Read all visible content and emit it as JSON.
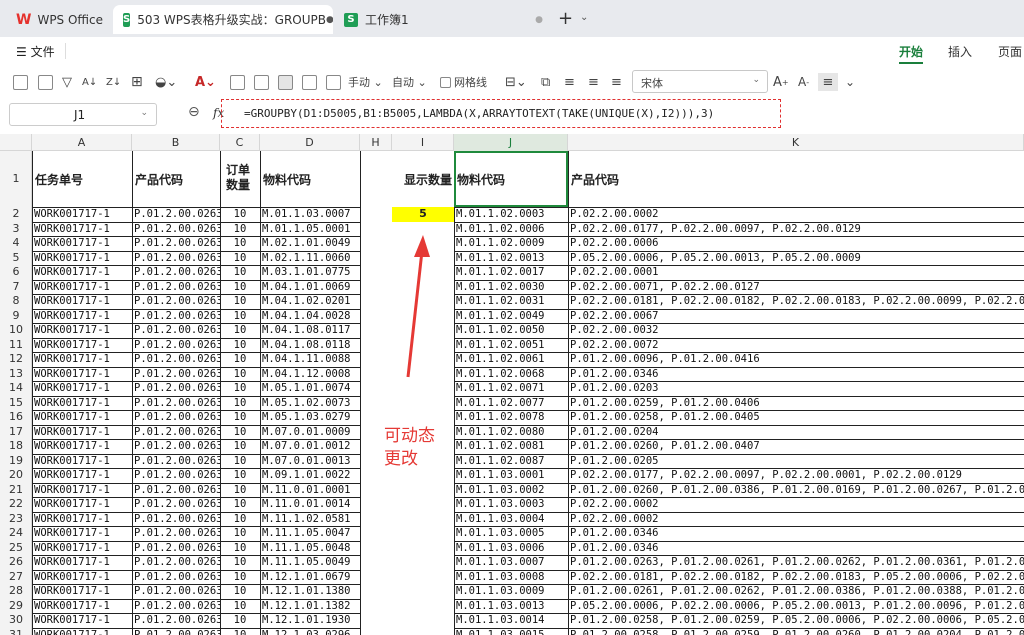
{
  "tabs": [
    {
      "label": "WPS Office"
    },
    {
      "label": "503 WPS表格升级实战：GROUPB"
    },
    {
      "label": "工作簿1"
    }
  ],
  "menu": {
    "file": "文件",
    "tabs": [
      "开始",
      "插入",
      "页面"
    ]
  },
  "toolbar": {
    "font": "宋体",
    "handle": "手动",
    "auto": "自动",
    "gridlines": "网格线"
  },
  "formula_bar": {
    "name_box": "J1",
    "formula": "=GROUPBY(D1:D5005,B1:B5005,LAMBDA(X,ARRAYTOTEXT(TAKE(UNIQUE(X),I2))),3)"
  },
  "columns": [
    "A",
    "B",
    "C",
    "D",
    "H",
    "I",
    "J",
    "K"
  ],
  "headers": {
    "A": "任务单号",
    "B": "产品代码",
    "C1": "订单",
    "C2": "数量",
    "D": "物料代码",
    "I": "显示数量",
    "J": "物料代码",
    "K": "产品代码"
  },
  "display_count": "5",
  "annotation": [
    "可动态",
    "更改"
  ],
  "row_numbers": [
    "1",
    "2",
    "3",
    "4",
    "5",
    "6",
    "7",
    "8",
    "9",
    "10",
    "11",
    "12",
    "13",
    "14",
    "15",
    "16",
    "17",
    "18",
    "19",
    "20",
    "21",
    "22",
    "23",
    "24",
    "25",
    "26",
    "27",
    "28",
    "29",
    "30",
    "31"
  ],
  "left_rows": [
    [
      "WORK001717-1",
      "P.01.2.00.0263",
      "10",
      "M.01.1.03.0007"
    ],
    [
      "WORK001717-1",
      "P.01.2.00.0263",
      "10",
      "M.01.1.05.0001"
    ],
    [
      "WORK001717-1",
      "P.01.2.00.0263",
      "10",
      "M.02.1.01.0049"
    ],
    [
      "WORK001717-1",
      "P.01.2.00.0263",
      "10",
      "M.02.1.11.0060"
    ],
    [
      "WORK001717-1",
      "P.01.2.00.0263",
      "10",
      "M.03.1.01.0775"
    ],
    [
      "WORK001717-1",
      "P.01.2.00.0263",
      "10",
      "M.04.1.01.0069"
    ],
    [
      "WORK001717-1",
      "P.01.2.00.0263",
      "10",
      "M.04.1.02.0201"
    ],
    [
      "WORK001717-1",
      "P.01.2.00.0263",
      "10",
      "M.04.1.04.0028"
    ],
    [
      "WORK001717-1",
      "P.01.2.00.0263",
      "10",
      "M.04.1.08.0117"
    ],
    [
      "WORK001717-1",
      "P.01.2.00.0263",
      "10",
      "M.04.1.08.0118"
    ],
    [
      "WORK001717-1",
      "P.01.2.00.0263",
      "10",
      "M.04.1.11.0088"
    ],
    [
      "WORK001717-1",
      "P.01.2.00.0263",
      "10",
      "M.04.1.12.0008"
    ],
    [
      "WORK001717-1",
      "P.01.2.00.0263",
      "10",
      "M.05.1.01.0074"
    ],
    [
      "WORK001717-1",
      "P.01.2.00.0263",
      "10",
      "M.05.1.02.0073"
    ],
    [
      "WORK001717-1",
      "P.01.2.00.0263",
      "10",
      "M.05.1.03.0279"
    ],
    [
      "WORK001717-1",
      "P.01.2.00.0263",
      "10",
      "M.07.0.01.0009"
    ],
    [
      "WORK001717-1",
      "P.01.2.00.0263",
      "10",
      "M.07.0.01.0012"
    ],
    [
      "WORK001717-1",
      "P.01.2.00.0263",
      "10",
      "M.07.0.01.0013"
    ],
    [
      "WORK001717-1",
      "P.01.2.00.0263",
      "10",
      "M.09.1.01.0022"
    ],
    [
      "WORK001717-1",
      "P.01.2.00.0263",
      "10",
      "M.11.0.01.0001"
    ],
    [
      "WORK001717-1",
      "P.01.2.00.0263",
      "10",
      "M.11.0.01.0014"
    ],
    [
      "WORK001717-1",
      "P.01.2.00.0263",
      "10",
      "M.11.1.02.0581"
    ],
    [
      "WORK001717-1",
      "P.01.2.00.0263",
      "10",
      "M.11.1.05.0047"
    ],
    [
      "WORK001717-1",
      "P.01.2.00.0263",
      "10",
      "M.11.1.05.0048"
    ],
    [
      "WORK001717-1",
      "P.01.2.00.0263",
      "10",
      "M.11.1.05.0049"
    ],
    [
      "WORK001717-1",
      "P.01.2.00.0263",
      "10",
      "M.12.1.01.0679"
    ],
    [
      "WORK001717-1",
      "P.01.2.00.0263",
      "10",
      "M.12.1.01.1380"
    ],
    [
      "WORK001717-1",
      "P.01.2.00.0263",
      "10",
      "M.12.1.01.1382"
    ],
    [
      "WORK001717-1",
      "P.01.2.00.0263",
      "10",
      "M.12.1.01.1930"
    ],
    [
      "WORK001717-1",
      "P.01.2.00.0263",
      "10",
      "M.12.1.03.0296"
    ]
  ],
  "right_rows": [
    [
      "M.01.1.02.0003",
      "P.02.2.00.0002"
    ],
    [
      "M.01.1.02.0006",
      "P.02.2.00.0177, P.02.2.00.0097, P.02.2.00.0129"
    ],
    [
      "M.01.1.02.0009",
      "P.02.2.00.0006"
    ],
    [
      "M.01.1.02.0013",
      "P.05.2.00.0006, P.05.2.00.0013, P.05.2.00.0009"
    ],
    [
      "M.01.1.02.0017",
      "P.02.2.00.0001"
    ],
    [
      "M.01.1.02.0030",
      "P.02.2.00.0071, P.02.2.00.0127"
    ],
    [
      "M.01.1.02.0031",
      "P.02.2.00.0181, P.02.2.00.0182, P.02.2.00.0183, P.02.2.00.0099, P.02.2.0"
    ],
    [
      "M.01.1.02.0049",
      "P.02.2.00.0067"
    ],
    [
      "M.01.1.02.0050",
      "P.02.2.00.0032"
    ],
    [
      "M.01.1.02.0051",
      "P.02.2.00.0072"
    ],
    [
      "M.01.1.02.0061",
      "P.01.2.00.0096, P.01.2.00.0416"
    ],
    [
      "M.01.1.02.0068",
      "P.01.2.00.0346"
    ],
    [
      "M.01.1.02.0071",
      "P.01.2.00.0203"
    ],
    [
      "M.01.1.02.0077",
      "P.01.2.00.0259, P.01.2.00.0406"
    ],
    [
      "M.01.1.02.0078",
      "P.01.2.00.0258, P.01.2.00.0405"
    ],
    [
      "M.01.1.02.0080",
      "P.01.2.00.0204"
    ],
    [
      "M.01.1.02.0081",
      "P.01.2.00.0260, P.01.2.00.0407"
    ],
    [
      "M.01.1.02.0087",
      "P.01.2.00.0205"
    ],
    [
      "M.01.1.03.0001",
      "P.02.2.00.0177, P.02.2.00.0097, P.02.2.00.0001, P.02.2.00.0129"
    ],
    [
      "M.01.1.03.0002",
      "P.01.2.00.0260, P.01.2.00.0386, P.01.2.00.0169, P.01.2.00.0267, P.01.2.0"
    ],
    [
      "M.01.1.03.0003",
      "P.02.2.00.0002"
    ],
    [
      "M.01.1.03.0004",
      "P.02.2.00.0002"
    ],
    [
      "M.01.1.03.0005",
      "P.01.2.00.0346"
    ],
    [
      "M.01.1.03.0006",
      "P.01.2.00.0346"
    ],
    [
      "M.01.1.03.0007",
      "P.01.2.00.0263, P.01.2.00.0261, P.01.2.00.0262, P.01.2.00.0361, P.01.2.0"
    ],
    [
      "M.01.1.03.0008",
      "P.02.2.00.0181, P.02.2.00.0182, P.02.2.00.0183, P.05.2.00.0006, P.02.2.0"
    ],
    [
      "M.01.1.03.0009",
      "P.01.2.00.0261, P.01.2.00.0262, P.01.2.00.0386, P.01.2.00.0388, P.01.2.0"
    ],
    [
      "M.01.1.03.0013",
      "P.05.2.00.0006, P.02.2.00.0006, P.05.2.00.0013, P.01.2.00.0096, P.01.2.0"
    ],
    [
      "M.01.1.03.0014",
      "P.01.2.00.0258, P.01.2.00.0259, P.05.2.00.0006, P.02.2.00.0006, P.05.2.0"
    ],
    [
      "M.01.1.03.0015",
      "P.01.2.00.0258, P.01.2.00.0259, P.01.2.00.0260, P.01.2.00.0204, P.01.2.0"
    ]
  ]
}
